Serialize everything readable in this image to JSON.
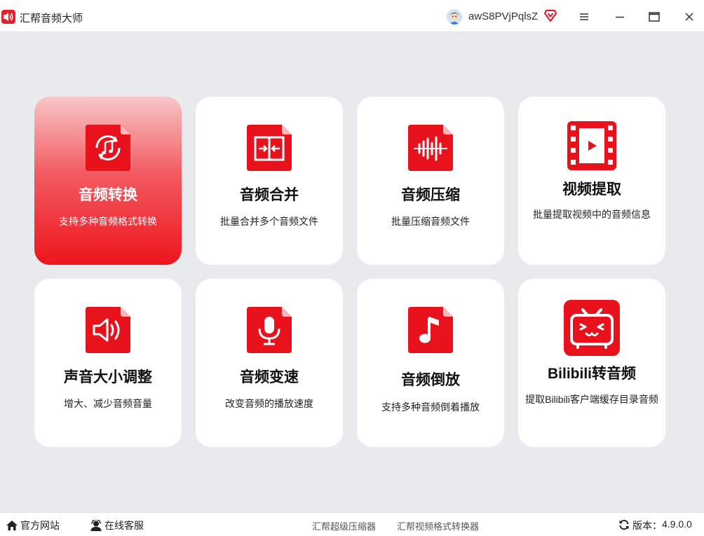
{
  "window": {
    "title": "汇帮音频大师",
    "username": "awS8PVjPqlsZ",
    "controls": [
      "menu-icon",
      "minimize-icon",
      "maximize-icon",
      "close-icon"
    ]
  },
  "features": [
    {
      "title": "音频转换",
      "desc": "支持多种音频格式转换",
      "icon": "audio-convert-icon",
      "active": true
    },
    {
      "title": "音频合并",
      "desc": "批量合并多个音频文件",
      "icon": "audio-merge-icon",
      "active": false
    },
    {
      "title": "音频压缩",
      "desc": "批量压缩音频文件",
      "icon": "audio-compress-icon",
      "active": false
    },
    {
      "title": "视频提取",
      "desc": "批量提取视频中的音频信息",
      "icon": "video-extract-icon",
      "active": false
    },
    {
      "title": "声音大小调整",
      "desc": "增大、减少音频音量",
      "icon": "volume-adjust-icon",
      "active": false
    },
    {
      "title": "音频变速",
      "desc": "改变音频的播放速度",
      "icon": "audio-speed-icon",
      "active": false
    },
    {
      "title": "音频倒放",
      "desc": "支持多种音频倒着播放",
      "icon": "audio-reverse-icon",
      "active": false
    },
    {
      "title": "Bilibili转音频",
      "desc": "提取Bilibili客户端缓存目录音频",
      "icon": "bilibili-tv-icon",
      "active": false
    }
  ],
  "footer": {
    "website": "官方网站",
    "support": "在线客服",
    "links": [
      "汇帮超级压缩器",
      "汇帮视频格式转换器"
    ],
    "version_label": "版本：",
    "version": "4.9.0.0"
  },
  "colors": {
    "accent": "#ee141c",
    "background": "#e9eaee",
    "card": "#ffffff"
  }
}
